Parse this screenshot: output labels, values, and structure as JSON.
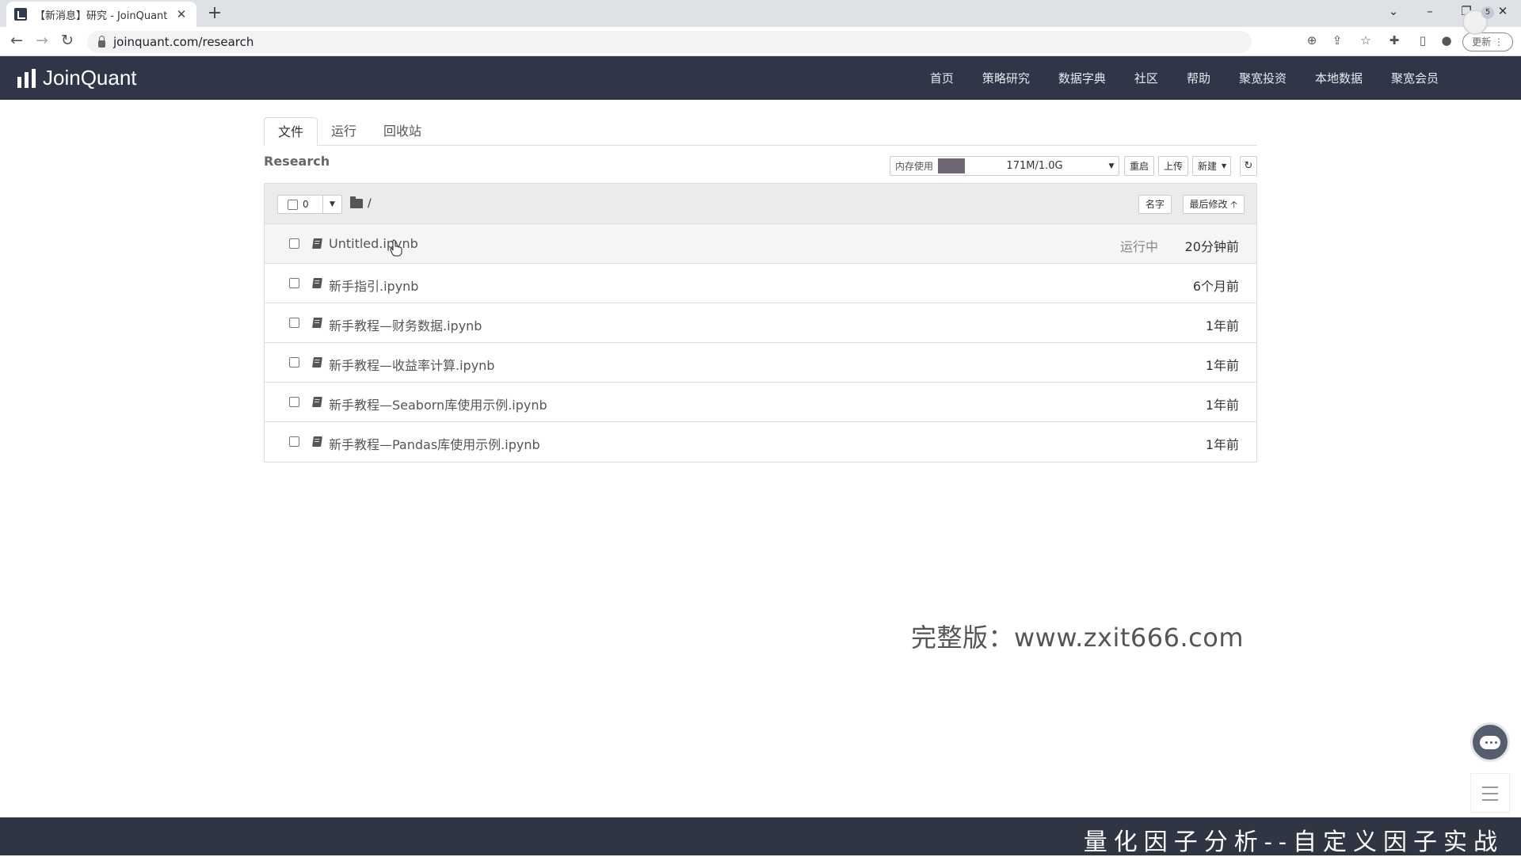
{
  "browser": {
    "tab_title": "【新消息】研究 - JoinQuant",
    "tab_close": "✕",
    "new_tab": "+",
    "url": "joinquant.com/research",
    "update_label": "更新 ⋮"
  },
  "header": {
    "logo_text": "JoinQuant",
    "nav": [
      "首页",
      "策略研究",
      "数据字典",
      "社区",
      "帮助",
      "聚宽投资",
      "本地数据",
      "聚宽会员"
    ],
    "notification_count": "5"
  },
  "tabs": [
    "文件",
    "运行",
    "回收站"
  ],
  "research_title": "Research",
  "toolbar": {
    "memory_label": "内存使用",
    "memory_value": "171M/1.0G",
    "memory_fraction": 0.17,
    "restart": "重启",
    "upload": "上传",
    "new": "新建"
  },
  "list": {
    "selected_count": "0",
    "path": "/",
    "sort_name": "名字",
    "sort_modified": "最后修改"
  },
  "files": [
    {
      "name": "Untitled.ipynb",
      "status": "运行中",
      "modified": "20分钟前"
    },
    {
      "name": "新手指引.ipynb",
      "status": "",
      "modified": "6个月前"
    },
    {
      "name": "新手教程—财务数据.ipynb",
      "status": "",
      "modified": "1年前"
    },
    {
      "name": "新手教程—收益率计算.ipynb",
      "status": "",
      "modified": "1年前"
    },
    {
      "name": "新手教程—Seaborn库使用示例.ipynb",
      "status": "",
      "modified": "1年前"
    },
    {
      "name": "新手教程—Pandas库使用示例.ipynb",
      "status": "",
      "modified": "1年前"
    }
  ],
  "watermark": "完整版：www.zxit666.com",
  "banner": "量化因子分析--自定义因子实战",
  "colors": {
    "header_bg": "#2e3648",
    "banner_bg": "#2f3542",
    "memory_bar": "#6f6773"
  }
}
